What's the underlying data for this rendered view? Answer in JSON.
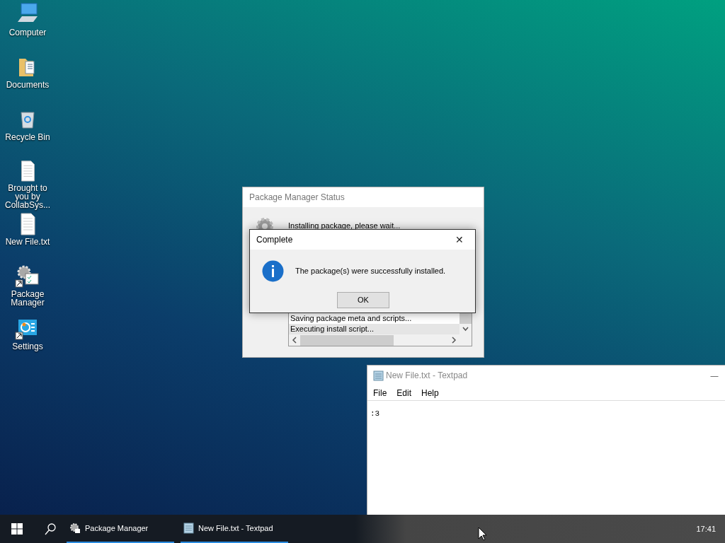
{
  "desktop_icons": [
    {
      "kind": "computer",
      "label": "Computer"
    },
    {
      "kind": "folder",
      "label": "Documents"
    },
    {
      "kind": "recycle",
      "label": "Recycle Bin"
    },
    {
      "kind": "document",
      "label": "Brought to you by CollabSys..."
    },
    {
      "kind": "document",
      "label": "New File.txt"
    },
    {
      "kind": "package",
      "label": "Package Manager",
      "shortcut": true
    },
    {
      "kind": "settings",
      "label": "Settings",
      "shortcut": true
    }
  ],
  "status_window": {
    "title": "Package Manager Status",
    "message": "Installing package, please wait...",
    "log": [
      "Saving package meta and scripts...",
      "Executing install script..."
    ]
  },
  "dialog": {
    "title": "Complete",
    "close": "✕",
    "message": "The package(s) were successfully installed.",
    "button": "OK"
  },
  "textpad": {
    "title": "New File.txt - Textpad",
    "minimize": "—",
    "menu": [
      "File",
      "Edit",
      "Help"
    ],
    "content": ":3"
  },
  "taskbar": {
    "items": [
      {
        "kind": "package",
        "label": "Package Manager",
        "running": true
      },
      {
        "kind": "notepad",
        "label": "New File.txt - Textpad",
        "running": true
      }
    ],
    "clock": "17:41"
  }
}
